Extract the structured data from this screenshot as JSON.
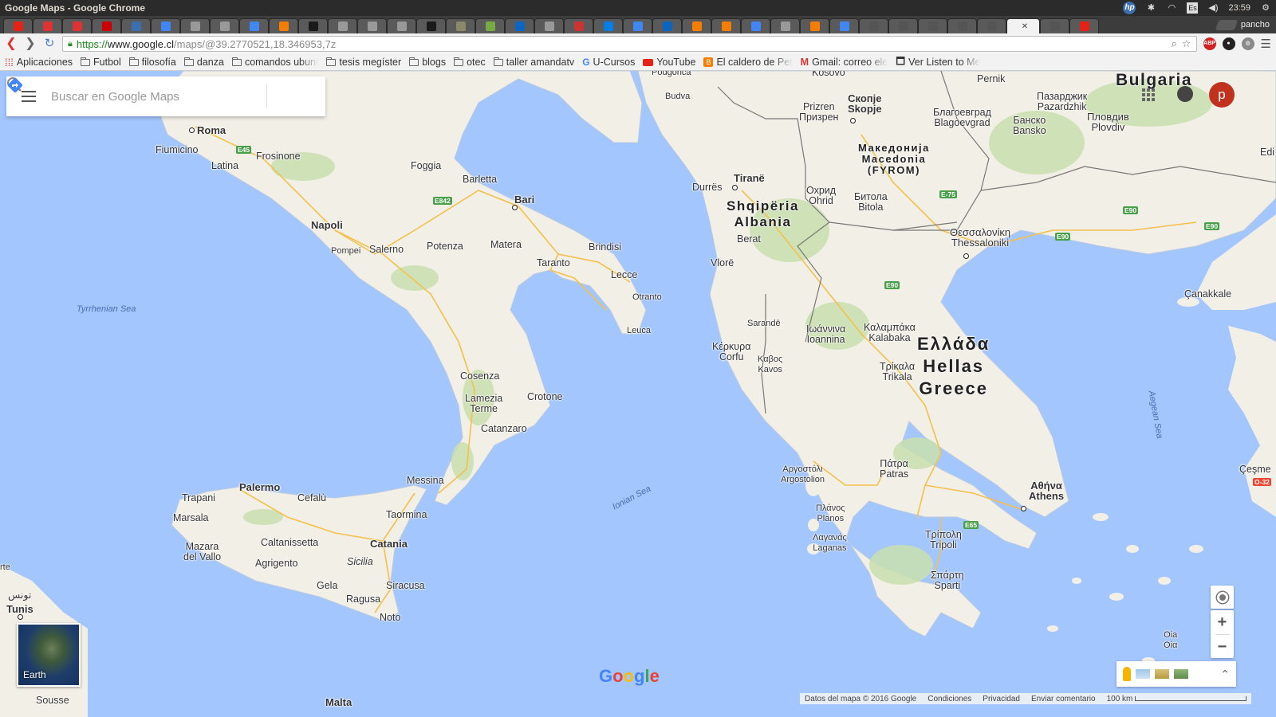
{
  "os": {
    "window_title": "Google Maps - Google Chrome",
    "lang": "Es",
    "clock": "23:59"
  },
  "browser": {
    "user": "pancho",
    "url_secure": "https://",
    "url_host": "www.google.cl",
    "url_path": "/maps/@39.2770521,18.346953,7z",
    "bookmarks": [
      "Aplicaciones",
      "Futbol",
      "filosofía",
      "danza",
      "comandos ubunt",
      "tesis megíster",
      "blogs",
      "otec",
      "taller amandatv",
      "U-Cursos",
      "YouTube",
      "El caldero de Pet",
      "Gmail: correo ele",
      "Ver Listen to Me"
    ]
  },
  "maps": {
    "search_placeholder": "Buscar en Google Maps",
    "account_initial": "p",
    "earth_label": "Earth",
    "footer": {
      "map_data": "Datos del mapa © 2016 Google",
      "terms": "Condiciones",
      "privacy": "Privacidad",
      "feedback": "Enviar comentario",
      "scale": "100 km"
    }
  },
  "map_labels": {
    "roma": "Roma",
    "fiumicino": "Fiumicino",
    "frosinone": "Frosinone",
    "latina": "Latina",
    "foggia": "Foggia",
    "barletta": "Barletta",
    "bari": "Bari",
    "napoli": "Napoli",
    "pompei": "Pompei",
    "salerno": "Salerno",
    "potenza": "Potenza",
    "matera": "Matera",
    "brindisi": "Brindisi",
    "taranto": "Taranto",
    "lecce": "Lecce",
    "otranto": "Otranto",
    "leuca": "Leuca",
    "tyrrhenian": "Tyrrhenian Sea",
    "cosenza": "Cosenza",
    "crotone": "Crotone",
    "lamezia": "Lamezia\nTerme",
    "catanzaro": "Catanzaro",
    "ionian": "Ionian Sea",
    "messina": "Messina",
    "palermo": "Palermo",
    "trapani": "Trapani",
    "cefalu": "Cefalù",
    "taormina": "Taormina",
    "marsala": "Marsala",
    "mazara": "Mazara\ndel Vallo",
    "caltanissetta": "Caltanissetta",
    "catania": "Catania",
    "agrigento": "Agrigento",
    "sicilia": "Sicilia",
    "gela": "Gela",
    "siracusa": "Siracusa",
    "ragusa": "Ragusa",
    "noto": "Noto",
    "tunis_ar": "تونس",
    "tunis": "Tunis",
    "sousse": "Sousse",
    "malta": "Malta",
    "budva": "Budva",
    "kosovo": "Kosovo",
    "podgorica": "Podgorica",
    "prizren": "Prizren\nПризрен",
    "skopje": "Скопје\nSkopje",
    "blagoevgrad": "Благоевград\nBlagoevgrad",
    "pernik": "Pernik",
    "pazardzhik": "Пазарджик\nPazardzhik",
    "bansko": "Банско\nBansko",
    "plovdiv": "Пловдив\nPlovdiv",
    "bulgaria": "Bulgaria",
    "edirne": "Edi",
    "tirana": "Tiranë",
    "durres": "Durrës",
    "macedonia": "Македонија\nMacedonia\n(FYROM)",
    "ohrid": "Охрид\nOhrid",
    "bitola": "Битола\nBitola",
    "albania": "Shqipëria\nAlbania",
    "berat": "Berat",
    "vlore": "Vlorë",
    "thessaloniki": "Θεσσαλονίκη\nThessaloniki",
    "sarande": "Sarandë",
    "ioannina": "Ιωάννινα\nIoannina",
    "kalabaka": "Καλαμπάκα\nKalabaka",
    "corfu": "Κέρκυρα\nCorfu",
    "kavos": "Καβος\nKavos",
    "greece": "Ελλάδα\nHellas\nGreece",
    "trikala": "Τρίκαλα\nTrikala",
    "canakkale": "Çanakkale",
    "aegean": "Aegean Sea",
    "patras": "Πάτρα\nPatras",
    "argostoli": "Αργοστόλι\nArgostolion",
    "athens": "Αθήνα\nAthens",
    "cesme": "Çeşme",
    "planos": "Πλάνος\nPlanos",
    "laganas": "Λαγανάς\nLaganas",
    "tripoli": "Τρίπολη\nTripoli",
    "sparti": "Σπάρτη\nSparti",
    "oia": "Oia\nΟία",
    "rte": "rte"
  },
  "road_labels": {
    "e45": "E45",
    "e842": "E842",
    "e75": "E-75",
    "e90a": "E90",
    "e90b": "E90",
    "e90c": "E90",
    "e90d": "E90",
    "e65": "E65",
    "o32": "O-32"
  },
  "colors": {
    "sea": "#a3c6ff",
    "land": "#f2efe6",
    "green": "#c9dfae",
    "road": "#f5c04a",
    "border": "#777777",
    "account": "#c1321e"
  }
}
